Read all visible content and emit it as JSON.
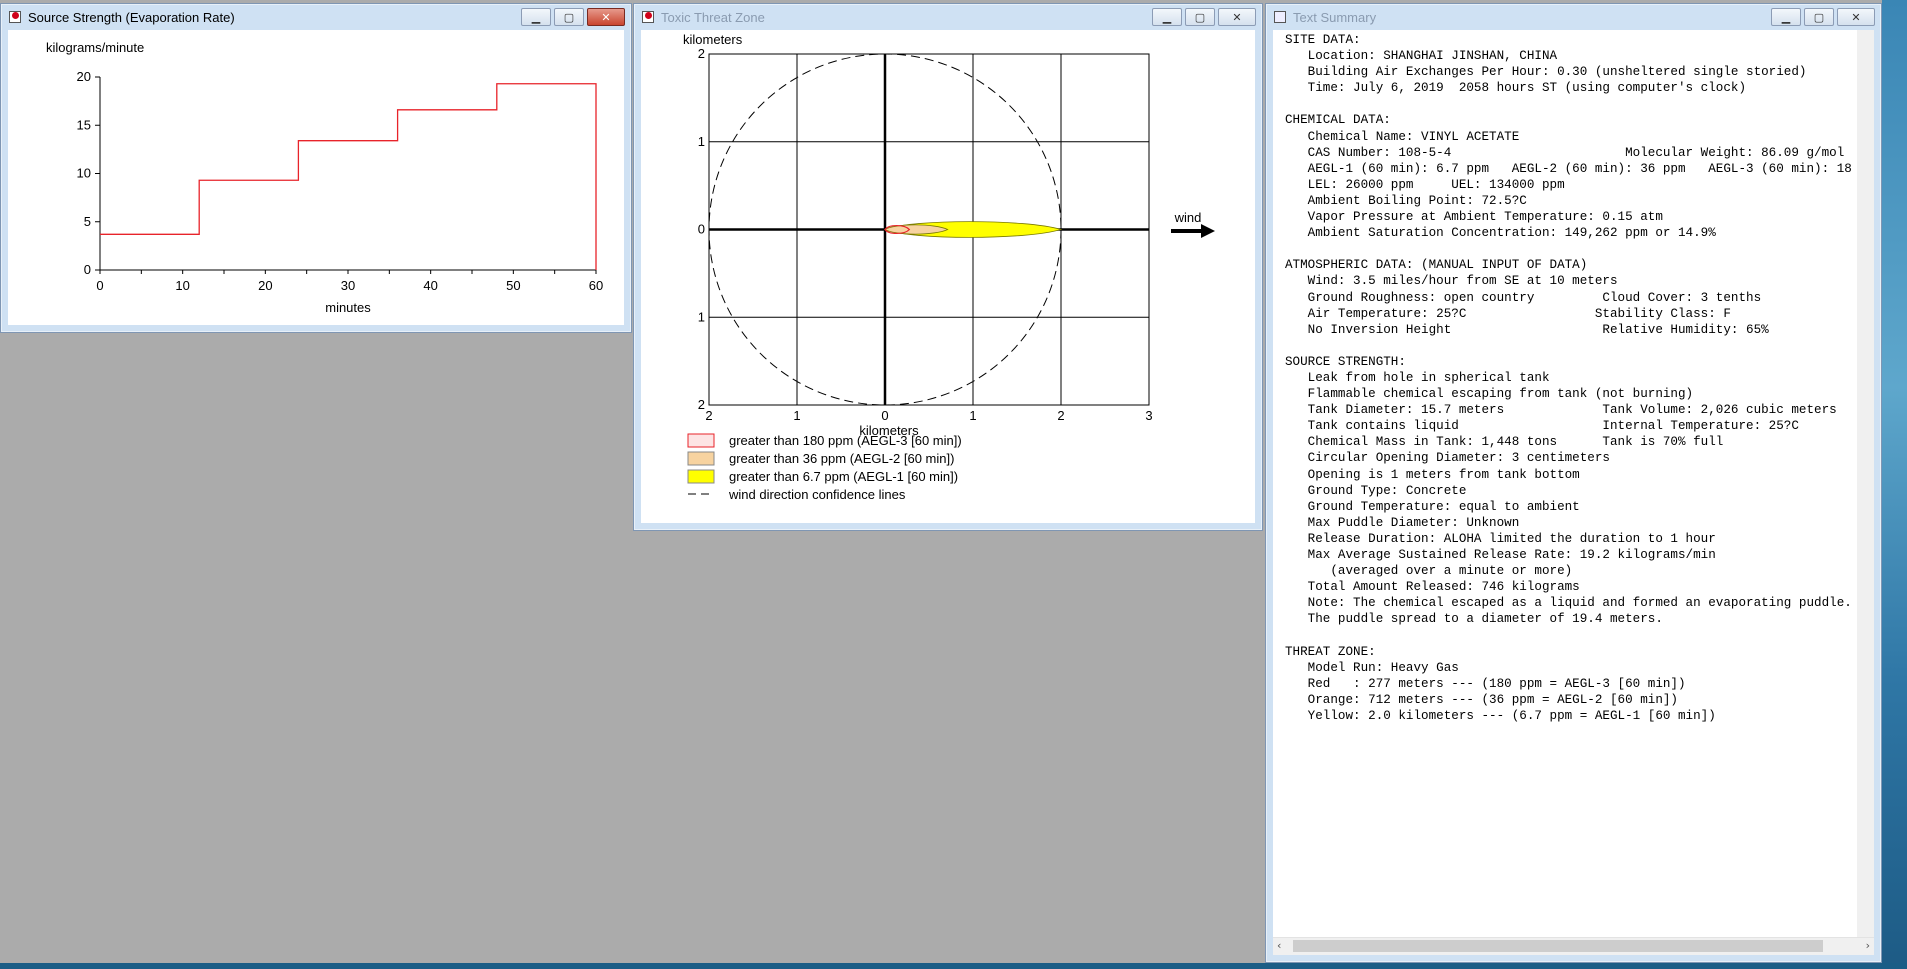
{
  "source_window": {
    "title": "Source Strength (Evaporation Rate)",
    "chart_data": {
      "type": "line",
      "step": true,
      "ylabel": "kilograms/minute",
      "xlabel": "minutes",
      "xlim": [
        0,
        60
      ],
      "ylim": [
        0,
        20
      ],
      "xticks": [
        0,
        10,
        20,
        30,
        40,
        50,
        60
      ],
      "yticks": [
        0,
        5,
        10,
        15,
        20
      ],
      "series": [
        {
          "color": "#e8232a",
          "x": [
            0,
            12,
            12,
            24,
            24,
            36,
            36,
            48,
            48,
            60,
            60
          ],
          "y": [
            3.7,
            3.7,
            9.3,
            9.3,
            13.4,
            13.4,
            16.6,
            16.6,
            19.3,
            19.3,
            0
          ]
        }
      ]
    }
  },
  "threat_window": {
    "title": "Toxic Threat Zone",
    "chart_data": {
      "type": "area",
      "ylabel": "kilometers",
      "xlabel": "kilometers",
      "xlim": [
        -2,
        3
      ],
      "ylim": [
        -2,
        2
      ],
      "xtick_labels": [
        "2",
        "1",
        "0",
        "1",
        "2",
        "3"
      ],
      "ytick_labels": [
        "2",
        "1",
        "0",
        "1",
        "2"
      ],
      "wind_label": "wind",
      "zones": [
        {
          "name": "greater than 6.7 ppm (AEGL-1 [60 min])",
          "color": "#ffff00",
          "x_from": 0,
          "x_to": 2.0,
          "half_width": 0.12
        },
        {
          "name": "greater than 36 ppm (AEGL-2 [60 min])",
          "color": "#f7d3a0",
          "x_from": 0,
          "x_to": 0.712,
          "half_width": 0.07
        },
        {
          "name": "greater than 180 ppm (AEGL-3 [60 min])",
          "color": "#e8232a",
          "x_from": 0,
          "x_to": 0.277,
          "half_width": 0.06
        }
      ],
      "confidence_radius": 2.0,
      "confidence_label": "wind direction confidence lines"
    }
  },
  "summary_window": {
    "title": "Text Summary",
    "lines": [
      "SITE DATA:",
      "   Location: SHANGHAI JINSHAN, CHINA",
      "   Building Air Exchanges Per Hour: 0.30 (unsheltered single storied)",
      "   Time: July 6, 2019  2058 hours ST (using computer's clock)",
      "",
      "CHEMICAL DATA:",
      "   Chemical Name: VINYL ACETATE",
      "   CAS Number: 108-5-4                       Molecular Weight: 86.09 g/mol",
      "   AEGL-1 (60 min): 6.7 ppm   AEGL-2 (60 min): 36 ppm   AEGL-3 (60 min): 18",
      "   LEL: 26000 ppm     UEL: 134000 ppm",
      "   Ambient Boiling Point: 72.5?C",
      "   Vapor Pressure at Ambient Temperature: 0.15 atm",
      "   Ambient Saturation Concentration: 149,262 ppm or 14.9%",
      "",
      "ATMOSPHERIC DATA: (MANUAL INPUT OF DATA)",
      "   Wind: 3.5 miles/hour from SE at 10 meters",
      "   Ground Roughness: open country         Cloud Cover: 3 tenths",
      "   Air Temperature: 25?C                 Stability Class: F",
      "   No Inversion Height                    Relative Humidity: 65%",
      "",
      "SOURCE STRENGTH:",
      "   Leak from hole in spherical tank",
      "   Flammable chemical escaping from tank (not burning)",
      "   Tank Diameter: 15.7 meters             Tank Volume: 2,026 cubic meters",
      "   Tank contains liquid                   Internal Temperature: 25?C",
      "   Chemical Mass in Tank: 1,448 tons      Tank is 70% full",
      "   Circular Opening Diameter: 3 centimeters",
      "   Opening is 1 meters from tank bottom",
      "   Ground Type: Concrete",
      "   Ground Temperature: equal to ambient",
      "   Max Puddle Diameter: Unknown",
      "   Release Duration: ALOHA limited the duration to 1 hour",
      "   Max Average Sustained Release Rate: 19.2 kilograms/min",
      "      (averaged over a minute or more)",
      "   Total Amount Released: 746 kilograms",
      "   Note: The chemical escaped as a liquid and formed an evaporating puddle.",
      "   The puddle spread to a diameter of 19.4 meters.",
      "",
      "THREAT ZONE:",
      "   Model Run: Heavy Gas",
      "   Red   : 277 meters --- (180 ppm = AEGL-3 [60 min])",
      "   Orange: 712 meters --- (36 ppm = AEGL-2 [60 min])",
      "   Yellow: 2.0 kilometers --- (6.7 ppm = AEGL-1 [60 min])"
    ]
  },
  "window_buttons": {
    "minimize": "▁",
    "maximize": "▢",
    "close": "✕"
  },
  "scroll_arrows": {
    "left": "‹",
    "right": "›"
  }
}
